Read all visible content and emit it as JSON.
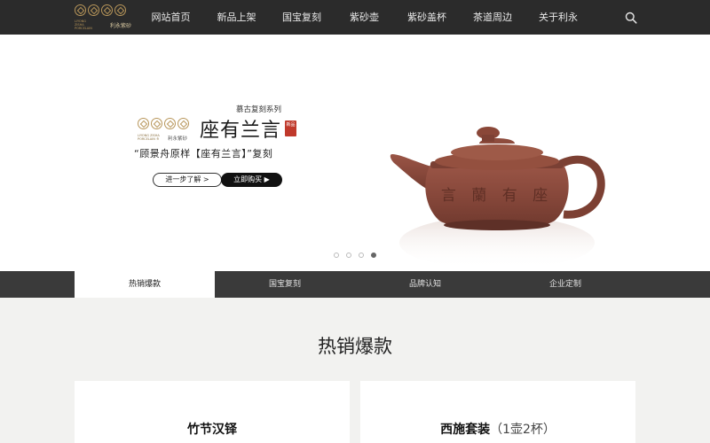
{
  "header": {
    "logo": {
      "en": "LIYONG ZISHA PORCELAIN",
      "cn": "利永紫砂"
    },
    "nav": [
      {
        "label": "网站首页"
      },
      {
        "label": "新品上架"
      },
      {
        "label": "国宝复刻"
      },
      {
        "label": "紫砂壶"
      },
      {
        "label": "紫砂盖杯"
      },
      {
        "label": "茶道周边"
      },
      {
        "label": "关于利永"
      }
    ],
    "search_icon": "search-icon"
  },
  "banner": {
    "series": "慕古复刻系列",
    "logo_en": "LIYONG ZISHA PORCELAIN ®",
    "logo_cn": "利永紫砂",
    "title": "座有兰言",
    "seal": "新品",
    "subtitle": "“顾景舟原样【座有兰言】”复刻",
    "btn_more": "进一步了解 >",
    "btn_buy": "立即购买 ▶",
    "teapot_inscription": "言 蘭 有 座",
    "carousel_active": 4,
    "carousel_total": 4
  },
  "tabs": [
    {
      "label": "热销爆款",
      "active": true
    },
    {
      "label": "国宝复刻",
      "active": false
    },
    {
      "label": "品牌认知",
      "active": false
    },
    {
      "label": "企业定制",
      "active": false
    }
  ],
  "section": {
    "title": "热销爆款",
    "products": [
      {
        "name": "竹节汉铎",
        "extra": ""
      },
      {
        "name": "西施套装",
        "extra": "（1壶2杯）"
      }
    ]
  },
  "colors": {
    "header_bg": "#2b2b2b",
    "gold": "#b8965a",
    "clay": "#8a4a3a"
  }
}
